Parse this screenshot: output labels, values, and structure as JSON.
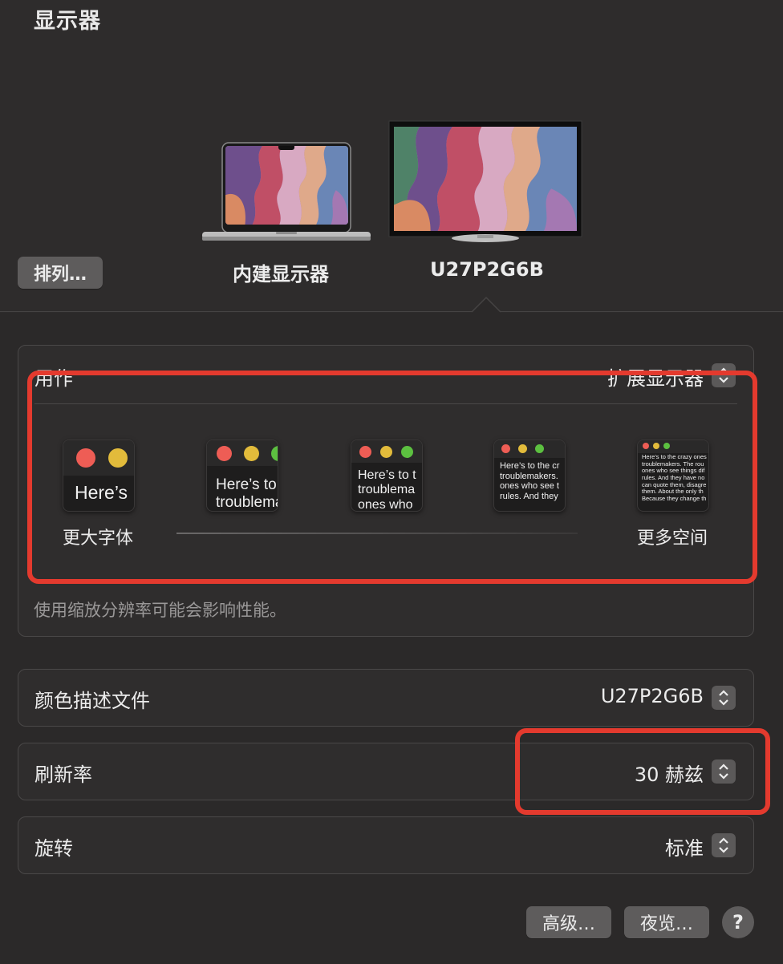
{
  "window": {
    "title": "显示器"
  },
  "arrange_button": "排列…",
  "displays": [
    {
      "name": "内建显示器"
    },
    {
      "name": "U27P2G6B"
    }
  ],
  "use_as": {
    "label": "用作",
    "value": "扩展显示器"
  },
  "scaling": {
    "thumbnails": [
      {
        "text": "Here’s"
      },
      {
        "text": "Here’s to t\ntroublema"
      },
      {
        "text": "Here’s to t\ntroublema\nones who"
      },
      {
        "text": "Here’s to the cr\ntroublemakers.\nones who see t\nrules. And they"
      },
      {
        "text": "Here’s to the crazy ones\ntroublemakers. The rou\nones who see things dif\nrules. And they have no\ncan quote them, disagre\nthem. About the only th\nBecause they change th"
      }
    ],
    "left_label": "更大字体",
    "right_label": "更多空间",
    "note": "使用缩放分辨率可能会影响性能。"
  },
  "color_profile": {
    "label": "颜色描述文件",
    "value": "U27P2G6B"
  },
  "refresh_rate": {
    "label": "刷新率",
    "value": "30 赫兹"
  },
  "rotation": {
    "label": "旋转",
    "value": "标准"
  },
  "buttons": {
    "advanced": "高级…",
    "night_shift": "夜览…",
    "help": "?"
  },
  "colors": {
    "highlight": "#e43a2e",
    "dot_red": "#ee5d55",
    "dot_yellow": "#e2bb3b",
    "dot_green": "#5cc040"
  }
}
